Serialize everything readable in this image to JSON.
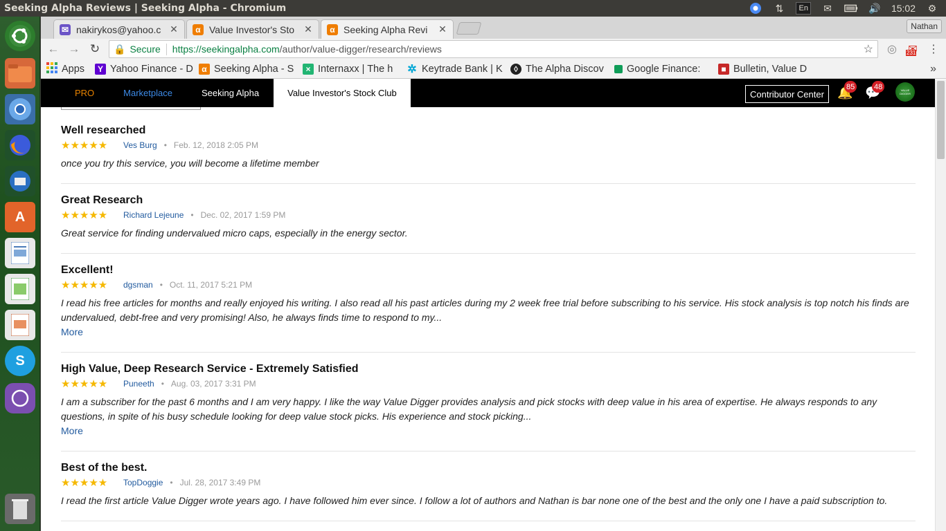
{
  "os": {
    "window_title": "Seeking Alpha Reviews | Seeking Alpha - Chromium",
    "keyboard": "En",
    "clock": "15:02"
  },
  "tabs": [
    {
      "label": "nakirykos@yahoo.c",
      "favicon": "mail-icon",
      "color": "#6b54c7"
    },
    {
      "label": "Value Investor's Sto",
      "favicon": "seeking-alpha-icon",
      "color": "#ef7d00"
    },
    {
      "label": "Seeking Alpha Revi",
      "favicon": "seeking-alpha-icon",
      "color": "#ef7d00",
      "active": true
    }
  ],
  "profile_name": "Nathan",
  "omnibox": {
    "secure_label": "Secure",
    "url_host": "https://seekingalpha.com",
    "url_path": "/author/value-digger/research/reviews"
  },
  "gmail_count": "231",
  "bookmarks": [
    {
      "label": "Apps",
      "icon": "apps-grid-icon"
    },
    {
      "label": "Yahoo Finance - D",
      "icon": "yahoo-icon",
      "color": "#5f01d1"
    },
    {
      "label": "Seeking Alpha - S",
      "icon": "seeking-alpha-icon",
      "color": "#ef7d00"
    },
    {
      "label": "Internaxx | The h",
      "icon": "internaxx-icon",
      "color": "#22b573"
    },
    {
      "label": "Keytrade Bank | K",
      "icon": "keytrade-icon",
      "color": "#00a7d6"
    },
    {
      "label": "The Alpha Discov",
      "icon": "alpha-discovery-icon",
      "color": "#222222"
    },
    {
      "label": "Google Finance:",
      "icon": "google-finance-icon",
      "color": "#0f9d58"
    },
    {
      "label": "Bulletin, Value D",
      "icon": "bulletin-icon",
      "color": "#c62828"
    }
  ],
  "sitenav": {
    "items": [
      "PRO",
      "Marketplace",
      "Seeking Alpha",
      "Value Investor's Stock Club"
    ],
    "contributor": "Contributor Center",
    "notifications": "85",
    "messages": "48",
    "avatar_text": "VALUE DIGGER"
  },
  "reviews": [
    {
      "title": "Well researched",
      "stars": "★★★★★",
      "author": "Ves Burg",
      "date": "Feb. 12, 2018 2:05 PM",
      "text": "once you try this service, you will become a lifetime member",
      "more": ""
    },
    {
      "title": "Great Research",
      "stars": "★★★★★",
      "author": "Richard Lejeune",
      "date": "Dec. 02, 2017 1:59 PM",
      "text": "Great service for finding undervalued micro caps, especially in the energy sector.",
      "more": ""
    },
    {
      "title": "Excellent!",
      "stars": "★★★★★",
      "author": "dgsman",
      "date": "Oct. 11, 2017 5:21 PM",
      "text": "I read his free articles for months and really enjoyed his writing. I also read all his past articles during my 2 week free trial before subscribing to his service. His stock analysis is top notch his finds are undervalued, debt-free and very promising! Also, he always finds time to respond to my...",
      "more": "More"
    },
    {
      "title": "High Value, Deep Research Service - Extremely Satisfied",
      "stars": "★★★★★",
      "author": "Puneeth",
      "date": "Aug. 03, 2017 3:31 PM",
      "text": "I am a subscriber for the past 6 months and I am very happy. I like the way Value Digger provides analysis and pick stocks with deep value in his area of expertise. He always responds to any questions, in spite of his busy schedule looking for deep value stock picks. His experience and stock picking...",
      "more": "More"
    },
    {
      "title": "Best of the best.",
      "stars": "★★★★★",
      "author": "TopDoggie",
      "date": "Jul. 28, 2017 3:49 PM",
      "text": "I read the first article Value Digger wrote years ago. I have followed him ever since. I follow a lot of authors and Nathan is bar none one of the best and the only one I have a paid subscription to.",
      "more": ""
    }
  ]
}
